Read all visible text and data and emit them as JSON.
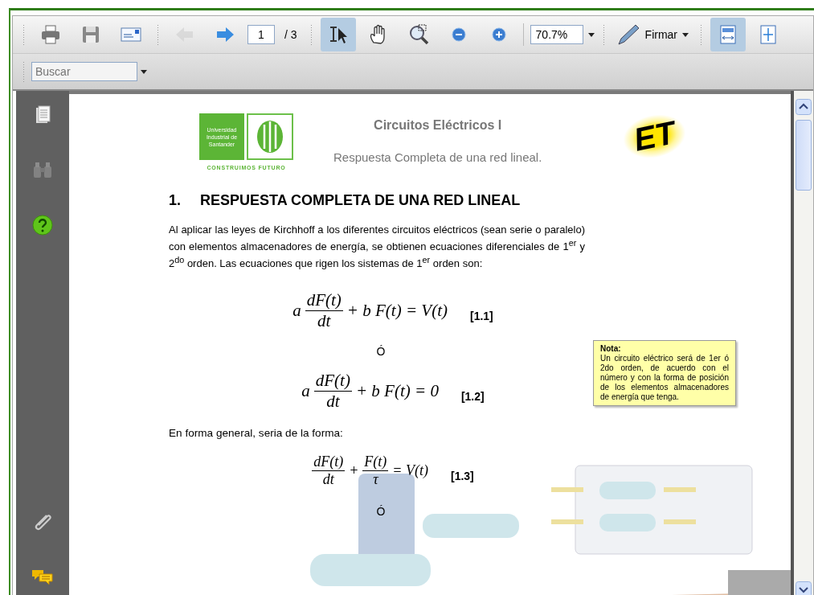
{
  "toolbar": {
    "groups": [
      [
        {
          "kind": "print",
          "selected": false,
          "disabled": false
        },
        {
          "kind": "save",
          "selected": false,
          "disabled": false
        },
        {
          "kind": "email",
          "selected": false,
          "disabled": false
        }
      ],
      [
        {
          "kind": "prev",
          "selected": false,
          "disabled": true
        },
        {
          "kind": "next",
          "selected": false,
          "disabled": false
        },
        {
          "kind": "page",
          "value": "1",
          "total": "/ 3"
        }
      ],
      [
        {
          "kind": "select",
          "selected": true,
          "disabled": false
        },
        {
          "kind": "hand",
          "selected": false,
          "disabled": false
        },
        {
          "kind": "marquee",
          "selected": false,
          "disabled": false
        },
        {
          "kind": "zoom-out",
          "selected": false,
          "disabled": false
        },
        {
          "kind": "zoom-in",
          "selected": false,
          "disabled": false
        },
        {
          "kind": "zoom",
          "value": "70.7%"
        }
      ],
      [
        {
          "kind": "sign",
          "label": "Firmar"
        }
      ],
      [
        {
          "kind": "fit-width",
          "selected": true,
          "disabled": false
        },
        {
          "kind": "fit-page",
          "selected": false,
          "disabled": false
        }
      ]
    ]
  },
  "search": {
    "placeholder": "Buscar"
  },
  "sidebar": {
    "top": [
      {
        "kind": "pages",
        "disabled": false
      },
      {
        "kind": "binoculars",
        "disabled": true
      },
      {
        "kind": "help",
        "disabled": false
      }
    ],
    "bottom": [
      {
        "kind": "attachment",
        "disabled": false
      },
      {
        "kind": "comments",
        "disabled": false
      }
    ]
  },
  "document": {
    "logo": {
      "name": "Universidad Industrial de Santander",
      "tagline": "CONSTRUIMOS FUTURO"
    },
    "course": "Circuitos Eléctricos I",
    "subtitle": "Respuesta Completa de una red lineal.",
    "badge": "ET",
    "heading_number": "1.",
    "heading": "RESPUESTA COMPLETA DE UNA RED LINEAL",
    "paragraph": "Al aplicar las leyes de Kirchhoff a los diferentes circuitos eléctricos (sean serie o paralelo) con elementos almacenadores de energía, se obtienen ecuaciones diferenciales de 1$^{er}$ y 2$^{do}$ orden. Las ecuaciones que rigen los sistemas de 1$^{er}$ orden son:",
    "blocks": [
      {
        "kind": "equation",
        "terms": [
          {
            "kind": "text",
            "text": "a"
          },
          {
            "kind": "frac",
            "num": "dF(t)",
            "den": "dt"
          },
          {
            "kind": "text",
            "text": "+ b F(t) = V(t)"
          }
        ],
        "label": "[1.1]"
      },
      {
        "kind": "or",
        "text": "Ó"
      },
      {
        "kind": "equation",
        "terms": [
          {
            "kind": "text",
            "text": "a"
          },
          {
            "kind": "frac",
            "num": "dF(t)",
            "den": "dt"
          },
          {
            "kind": "text",
            "text": "+ b F(t) = 0"
          }
        ],
        "label": "[1.2]"
      },
      {
        "kind": "text",
        "text": "En forma general, seria de la forma:"
      },
      {
        "kind": "equation",
        "terms": [
          {
            "kind": "frac",
            "num": "dF(t)",
            "den": "dt"
          },
          {
            "kind": "text",
            "text": "+"
          },
          {
            "kind": "frac",
            "num": "F(t)",
            "den": "τ"
          },
          {
            "kind": "text",
            "text": "= V(t)"
          }
        ],
        "label": "[1.3]"
      },
      {
        "kind": "or",
        "text": "Ó"
      }
    ],
    "note": {
      "title": "Nota:",
      "text": "Un circuito eléctrico será de 1er ó 2do orden, de acuerdo con el número y con la forma de posición de los elementos almacenadores de energía que tenga."
    }
  }
}
